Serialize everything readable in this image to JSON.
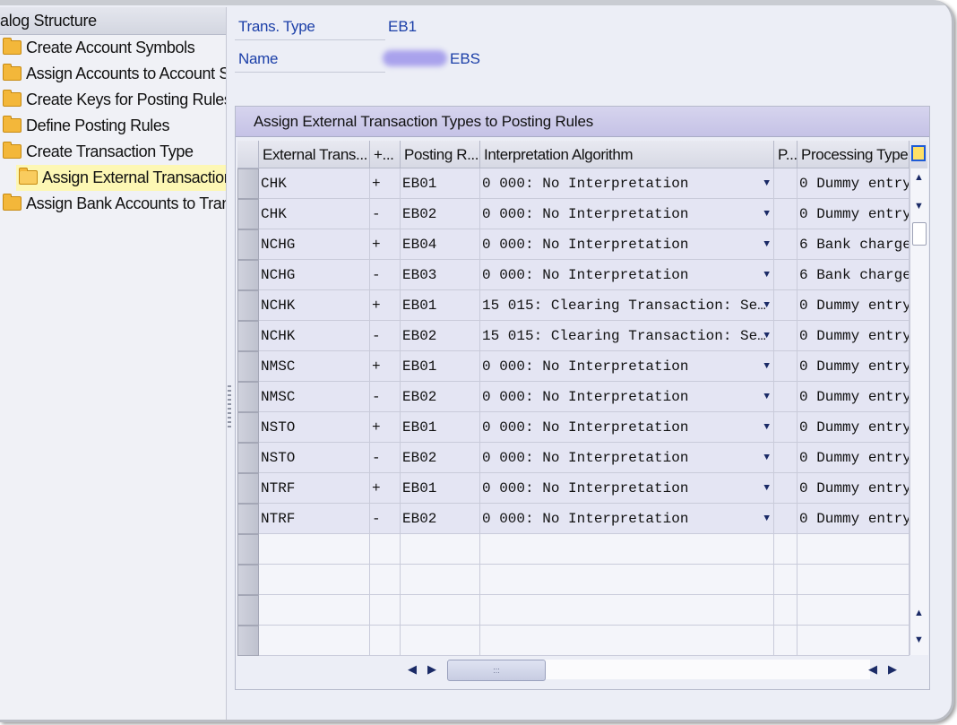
{
  "tree": {
    "header": "alog Structure",
    "items": [
      {
        "label": "Create Account Symbols",
        "selected": false
      },
      {
        "label": "Assign Accounts to Account Sy",
        "selected": false
      },
      {
        "label": "Create Keys for Posting Rules",
        "selected": false
      },
      {
        "label": "Define Posting Rules",
        "selected": false
      },
      {
        "label": "Create Transaction Type",
        "selected": false
      },
      {
        "label": "Assign External Transaction",
        "selected": true
      },
      {
        "label": "Assign Bank Accounts to Trans",
        "selected": false
      }
    ]
  },
  "header_fields": {
    "trans_type_label": "Trans. Type",
    "trans_type_value": "EB1",
    "name_label": "Name",
    "name_value": "EBS"
  },
  "table": {
    "title": "Assign External Transaction Types to Posting Rules",
    "columns": [
      "External Trans...",
      "+...",
      "Posting R...",
      "Interpretation Algorithm",
      "P...",
      "Processing Type"
    ],
    "rows": [
      {
        "ext": "CHK",
        "sign": "+",
        "rule": "EB01",
        "algo": "0 000: No Interpretation",
        "p": "",
        "proc": "0 Dummy entry"
      },
      {
        "ext": "CHK",
        "sign": "-",
        "rule": "EB02",
        "algo": "0 000: No Interpretation",
        "p": "",
        "proc": "0 Dummy entry"
      },
      {
        "ext": "NCHG",
        "sign": "+",
        "rule": "EB04",
        "algo": "0 000: No Interpretation",
        "p": "",
        "proc": "6 Bank charge"
      },
      {
        "ext": "NCHG",
        "sign": "-",
        "rule": "EB03",
        "algo": "0 000: No Interpretation",
        "p": "",
        "proc": "6 Bank charge"
      },
      {
        "ext": "NCHK",
        "sign": "+",
        "rule": "EB01",
        "algo": "15 015: Clearing Transaction: Se…",
        "p": "",
        "proc": "0 Dummy entry"
      },
      {
        "ext": "NCHK",
        "sign": "-",
        "rule": "EB02",
        "algo": "15 015: Clearing Transaction: Se…",
        "p": "",
        "proc": "0 Dummy entry"
      },
      {
        "ext": "NMSC",
        "sign": "+",
        "rule": "EB01",
        "algo": "0 000: No Interpretation",
        "p": "",
        "proc": "0 Dummy entry"
      },
      {
        "ext": "NMSC",
        "sign": "-",
        "rule": "EB02",
        "algo": "0 000: No Interpretation",
        "p": "",
        "proc": "0 Dummy entry"
      },
      {
        "ext": "NSTO",
        "sign": "+",
        "rule": "EB01",
        "algo": "0 000: No Interpretation",
        "p": "",
        "proc": "0 Dummy entry"
      },
      {
        "ext": "NSTO",
        "sign": "-",
        "rule": "EB02",
        "algo": "0 000: No Interpretation",
        "p": "",
        "proc": "0 Dummy entry"
      },
      {
        "ext": "NTRF",
        "sign": "+",
        "rule": "EB01",
        "algo": "0 000: No Interpretation",
        "p": "",
        "proc": "0 Dummy entry"
      },
      {
        "ext": "NTRF",
        "sign": "-",
        "rule": "EB02",
        "algo": "0 000: No Interpretation",
        "p": "",
        "proc": "0 Dummy entry"
      }
    ],
    "empty_rows": 4,
    "hscroll_thumb_text": ":::"
  },
  "icons": {
    "folder": "folder-icon",
    "open_folder": "open-folder-icon",
    "dropdown": "chevron-down-icon",
    "column_settings": "column-settings-icon"
  },
  "colors": {
    "accent_text": "#1b3fa8",
    "selection_highlight": "#fdf7b4",
    "panel_title_bg": "#c5c2e6"
  }
}
